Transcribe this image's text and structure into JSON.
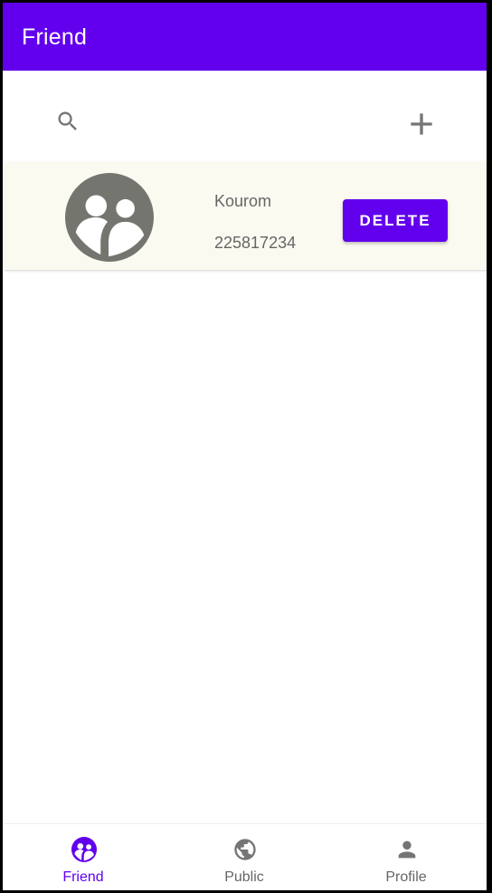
{
  "app_bar": {
    "title": "Friend"
  },
  "toolbar": {
    "search_icon": "search-icon",
    "add_icon": "plus-icon"
  },
  "friends": [
    {
      "name": "Kourom",
      "id": "225817234",
      "avatar_icon": "group-icon",
      "delete_label": "DELETE"
    }
  ],
  "bottom_nav": {
    "items": [
      {
        "label": "Friend",
        "icon": "group-icon",
        "active": true
      },
      {
        "label": "Public",
        "icon": "globe-icon",
        "active": false
      },
      {
        "label": "Profile",
        "icon": "person-icon",
        "active": false
      }
    ]
  },
  "colors": {
    "primary": "#6200ee",
    "icon_gray": "#757575",
    "text_gray": "#666666",
    "row_background": "#fbfaf1",
    "avatar_gray": "#757570"
  }
}
